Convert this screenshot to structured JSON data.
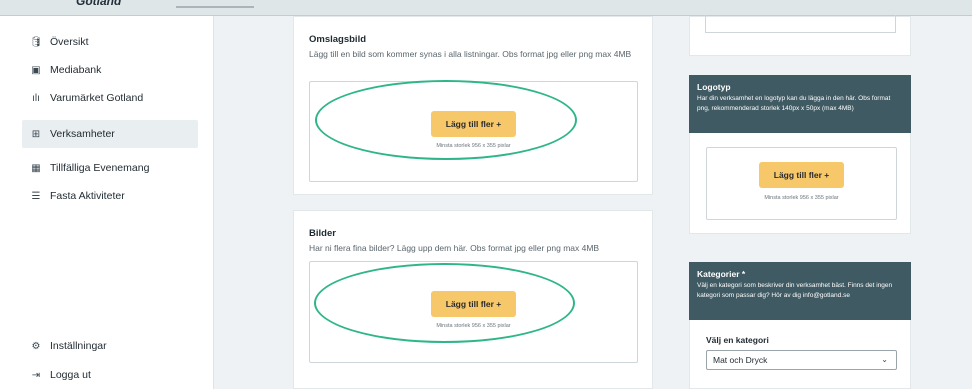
{
  "brand": {
    "logo": "Gotland"
  },
  "sidebar": {
    "items": [
      {
        "label": "Översikt",
        "icon": "database-icon",
        "glyph": "🛢"
      },
      {
        "label": "Mediabank",
        "icon": "image-icon",
        "glyph": "▣"
      },
      {
        "label": "Varumärket Gotland",
        "icon": "brand-icon",
        "glyph": "ılı"
      },
      {
        "label": "Verksamheter",
        "icon": "sitemap-icon",
        "glyph": "⊞"
      },
      {
        "label": "Tillfälliga Evenemang",
        "icon": "calendar-icon",
        "glyph": "▦"
      },
      {
        "label": "Fasta Aktiviteter",
        "icon": "list-icon",
        "glyph": "☰"
      }
    ],
    "bottom": [
      {
        "label": "Inställningar",
        "icon": "gear-icon",
        "glyph": "⚙"
      },
      {
        "label": "Logga ut",
        "icon": "logout-icon",
        "glyph": "⇥"
      }
    ]
  },
  "cover": {
    "title": "Omslagsbild",
    "description": "Lägg till en bild som kommer synas i alla listningar. Obs format jpg eller png max 4MB",
    "button": "Lägg till fler +",
    "hint": "Minsta storlek 956 x 355 pixlar"
  },
  "images": {
    "title": "Bilder",
    "description": "Har ni flera fina bilder? Lägg upp dem här. Obs format jpg eller png max 4MB",
    "button": "Lägg till fler +",
    "hint": "Minsta storlek 956 x 355 pixlar"
  },
  "logo_card": {
    "title": "Logotyp",
    "description": "Har din verksamhet en logotyp kan du lägga in den här. Obs format png, rekommenderad storlek 140px x 50px (max 4MB)",
    "button": "Lägg till fler +",
    "hint": "Minsta storlek 956 x 355 pixlar"
  },
  "categories": {
    "title": "Kategorier *",
    "description": "Välj en kategori som beskriver din verksamhet bäst. Finns det ingen kategori som passar dig? Hör av dig info@gotland.se",
    "select_label": "Välj en kategori",
    "selected": "Mat och Dryck"
  },
  "colors": {
    "accent": "#f7c86a",
    "highlight": "#2fb58a",
    "header_dark": "#3f5a63"
  }
}
